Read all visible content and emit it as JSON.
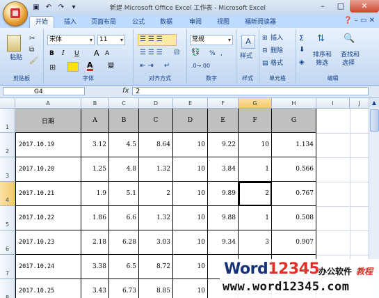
{
  "window": {
    "title": "新建 Microsoft Office Excel 工作表 - Microsoft Excel",
    "controls": [
      "–",
      "□",
      "✕"
    ]
  },
  "ribbon": {
    "tabs": [
      "开始",
      "插入",
      "页面布局",
      "公式",
      "数据",
      "审阅",
      "视图",
      "福昕阅读器"
    ],
    "active_tab": "开始",
    "clipboard": {
      "label": "剪贴板",
      "paste": "粘贴"
    },
    "font": {
      "label": "字体",
      "name": "宋体",
      "size": "11",
      "bold": "B",
      "italic": "I",
      "underline": "U",
      "grow": "A",
      "shrink": "A",
      "phonetic": "變"
    },
    "alignment": {
      "label": "对齐方式"
    },
    "number": {
      "label": "数字",
      "format": "常规",
      "percent": "%",
      "comma": ","
    },
    "styles": {
      "label": "样式"
    },
    "cells": {
      "label": "单元格",
      "insert": "插入",
      "delete": "删除",
      "format": "格式"
    },
    "editing": {
      "label": "编辑",
      "sort": "排序和",
      "sort2": "筛选",
      "find": "查找和",
      "find2": "选择"
    }
  },
  "formula_bar": {
    "name_box": "G4",
    "fx": "fx",
    "value": "2"
  },
  "columns": [
    "A",
    "B",
    "C",
    "D",
    "E",
    "F",
    "G",
    "H",
    "I",
    "J"
  ],
  "selected_column": "G",
  "selected_row": "4",
  "rows": [
    "1",
    "2",
    "3",
    "4",
    "5",
    "6",
    "7",
    "8"
  ],
  "table": {
    "headers": [
      "日期",
      "A",
      "B",
      "C",
      "D",
      "E",
      "F",
      "G"
    ],
    "rows": [
      [
        "2017.10.19",
        "3.12",
        "4.5",
        "8.64",
        "10",
        "9.22",
        "10",
        "1.134"
      ],
      [
        "2017.10.20",
        "1.25",
        "4.8",
        "1.32",
        "10",
        "3.84",
        "1",
        "0.566"
      ],
      [
        "2017.10.21",
        "1.9",
        "5.1",
        "2",
        "10",
        "9.89",
        "2",
        "0.767"
      ],
      [
        "2017.10.22",
        "1.86",
        "6.6",
        "1.32",
        "10",
        "9.88",
        "1",
        "0.508"
      ],
      [
        "2017.10.23",
        "2.18",
        "6.28",
        "3.03",
        "10",
        "9.34",
        "3",
        "0.907"
      ],
      [
        "2017.10.24",
        "3.38",
        "6.5",
        "8.72",
        "10",
        "",
        "",
        ""
      ],
      [
        "2017.10.25",
        "3.43",
        "6.73",
        "8.85",
        "10",
        "",
        "",
        ""
      ]
    ]
  },
  "watermark": {
    "brand_a": "Word",
    "brand_b": "12345",
    "cn_a": "办公软件",
    "cn_b": "教程",
    "url": "www.word12345.com"
  }
}
